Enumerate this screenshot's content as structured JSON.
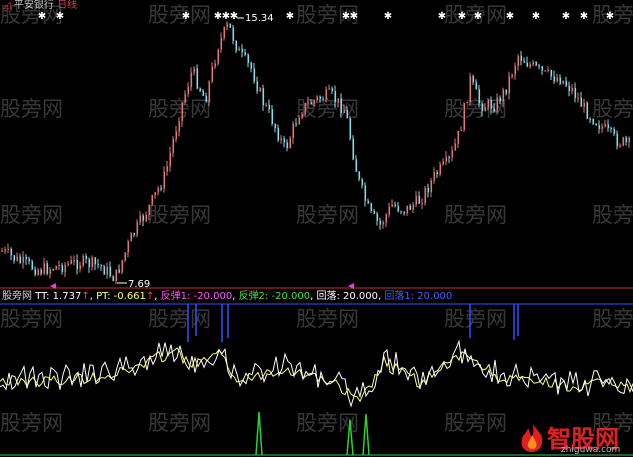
{
  "header": {
    "stock_name": "平安银行",
    "period": "日线",
    "menu_icon": "triangle-menu-icon"
  },
  "price_panel": {
    "high_label": "15.34",
    "low_label": "7.69",
    "star_marker_icon": "star-marker-icon",
    "triangle_marker_icon": "triangle-marker-icon"
  },
  "indicator_panel": {
    "name": "股旁网",
    "tt_label": "TT: 1.737",
    "pt_label": "PT: -0.661",
    "fantan1_label": "反弹1: -20.000",
    "fantan2_label": "反弹2: -20.000",
    "huiluo_label": "回落: 20.000",
    "huiluo1_label": "回落1: 20.000"
  },
  "watermark": "股旁网",
  "logo": {
    "brand": "智股网",
    "domain": "zhiguwa.com"
  },
  "colors": {
    "background": "#000000",
    "candle_up": "#e07878",
    "candle_down": "#8ed8e8",
    "separator": "#c03030",
    "tt_line": "#ffffff",
    "pt_line": "#ffff80",
    "fantan1": "#ff55ff",
    "fantan2": "#40e040",
    "huiluo": "#ffffff",
    "huiluo1": "#4060ff",
    "triangle_marker": "#e040e0",
    "green_spike": "#30d030",
    "blue_spike": "#3050ff"
  }
}
